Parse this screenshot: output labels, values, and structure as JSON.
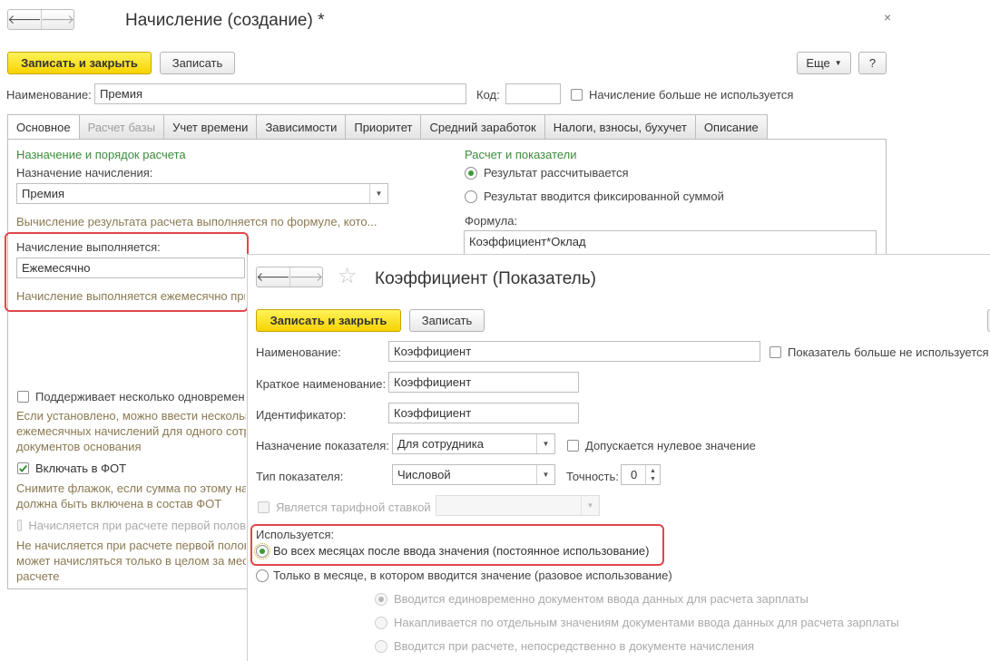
{
  "main": {
    "title": "Начисление (создание) *",
    "close_glyph": "×",
    "nav": {
      "back": "🡐",
      "forward": "🡒"
    },
    "toolbar": {
      "save_close": "Записать и закрыть",
      "save": "Записать",
      "more": "Еще",
      "help": "?"
    },
    "name_label": "Наименование:",
    "name_value": "Премия",
    "code_label": "Код:",
    "code_value": "",
    "not_used_label": "Начисление больше не используется",
    "tabs": [
      "Основное",
      "Расчет базы",
      "Учет времени",
      "Зависимости",
      "Приоритет",
      "Средний заработок",
      "Налоги, взносы, бухучет",
      "Описание"
    ],
    "left": {
      "section_title": "Назначение и порядок расчета",
      "purpose_label": "Назначение начисления:",
      "purpose_value": "Премия",
      "calc_hint": "Вычисление результата расчета выполняется по формуле, кото...",
      "performed_label": "Начисление выполняется:",
      "performed_value": "Ежемесячно",
      "performed_hint": "Начисление выполняется ежемесячно при",
      "multi_label": "Поддерживает несколько одновремен",
      "multi_hint": [
        "Если установлено, можно ввести нескольк",
        "ежемесячных начислений для одного сотр",
        "документов основания"
      ],
      "fot_label": "Включать в ФОТ",
      "fot_hint": [
        "Снимите флажок, если сумма по этому на",
        "должна быть включена в состав ФОТ"
      ],
      "first_half_label": "Начисляется при расчете первой полов",
      "first_half_hint": [
        "Не начисляется при расчете первой полов",
        "может начисляться только в целом за мес",
        "расчете"
      ]
    },
    "right": {
      "section_title": "Расчет и показатели",
      "radio_calc": "Результат рассчитывается",
      "radio_fixed": "Результат вводится фиксированной суммой",
      "formula_label": "Формула:",
      "formula_value": "Коэффициент*Оклад"
    }
  },
  "dialog": {
    "title": "Коэффициент (Показатель)",
    "star_glyph": "☆",
    "nav": {
      "back": "🡐",
      "forward": "🡒"
    },
    "toolbar": {
      "save_close": "Записать и закрыть",
      "save": "Записать"
    },
    "name_label": "Наименование:",
    "name_value": "Коэффициент",
    "not_used_label": "Показатель больше не используется",
    "short_label": "Краткое наименование:",
    "short_value": "Коэффициент",
    "id_label": "Идентификатор:",
    "id_value": "Коэффициент",
    "purpose_label": "Назначение показателя:",
    "purpose_value": "Для сотрудника",
    "zero_label": "Допускается нулевое значение",
    "type_label": "Тип показателя:",
    "type_value": "Числовой",
    "precision_label": "Точность:",
    "precision_value": "0",
    "tariff_label": "Является тарифной ставкой",
    "used_label": "Используется:",
    "used_options": [
      "Во всех месяцах после ввода значения (постоянное использование)",
      "Только в месяце, в котором вводится значение (разовое использование)"
    ],
    "sub_options": [
      "Вводится единовременно документом ввода данных для расчета зарплаты",
      "Накапливается по отдельным значениям документами ввода данных для расчета зарплаты",
      "Вводится при расчете, непосредственно в документе начисления"
    ]
  }
}
